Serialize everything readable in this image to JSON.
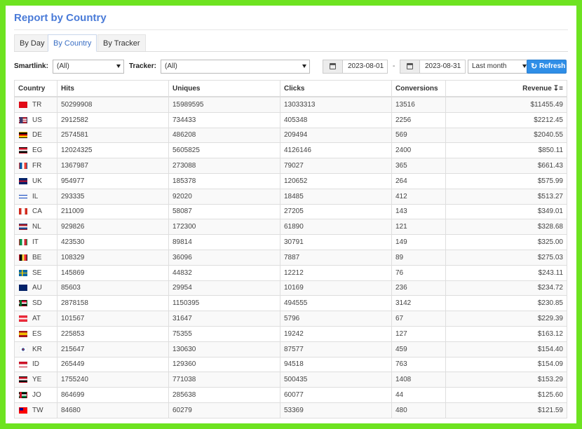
{
  "page": {
    "title": "Report by Country"
  },
  "tabs": [
    {
      "label": "By Day",
      "active": false
    },
    {
      "label": "By Country",
      "active": true
    },
    {
      "label": "By Tracker",
      "active": false
    }
  ],
  "filters": {
    "smartlink_label": "Smartlink:",
    "smartlink_value": "(All)",
    "tracker_label": "Tracker:",
    "tracker_value": "(All)",
    "date_from": "2023-08-01",
    "date_sep": "-",
    "date_to": "2023-08-31",
    "range_value": "Last month",
    "refresh_label": "Refresh"
  },
  "table": {
    "headers": {
      "country": "Country",
      "hits": "Hits",
      "uniques": "Uniques",
      "clicks": "Clicks",
      "conversions": "Conversions",
      "revenue": "Revenue"
    },
    "rows": [
      {
        "flag_css": "linear-gradient(#e30a17,#e30a17)",
        "code": "TR",
        "hits": "50299908",
        "uniques": "15989595",
        "clicks": "13033313",
        "conversions": "13516",
        "revenue": "$11455.49"
      },
      {
        "flag_css": "linear-gradient(to right,#3c3b6e 0,#3c3b6e 45%,transparent 45%),repeating-linear-gradient(#b22234 0,#b22234 1.4px,#fff 1.4px,#fff 2.8px)",
        "code": "US",
        "hits": "2912582",
        "uniques": "734433",
        "clicks": "405348",
        "conversions": "2256",
        "revenue": "$2212.45"
      },
      {
        "flag_css": "linear-gradient(#000 0,#000 33%,#dd0000 33%,#dd0000 66%,#ffce00 66%)",
        "code": "DE",
        "hits": "2574581",
        "uniques": "486208",
        "clicks": "209494",
        "conversions": "569",
        "revenue": "$2040.55"
      },
      {
        "flag_css": "linear-gradient(#ce1126 0,#ce1126 33%,#fff 33%,#fff 66%,#000 66%)",
        "code": "EG",
        "hits": "12024325",
        "uniques": "5605825",
        "clicks": "4126146",
        "conversions": "2400",
        "revenue": "$850.11"
      },
      {
        "flag_css": "linear-gradient(to right,#0055a4 0,#0055a4 33%,#fff 33%,#fff 66%,#ef4135 66%)",
        "code": "FR",
        "hits": "1367987",
        "uniques": "273088",
        "clicks": "79027",
        "conversions": "365",
        "revenue": "$661.43"
      },
      {
        "flag_css": "linear-gradient(#012169 0,#012169 38%,#c8102e 38%,#c8102e 62%,#012169 62%)",
        "code": "UK",
        "hits": "954977",
        "uniques": "185378",
        "clicks": "120652",
        "conversions": "264",
        "revenue": "$575.99"
      },
      {
        "flag_css": "linear-gradient(#fff 0,#fff 15%,#0038b8 15%,#0038b8 28%,#fff 28%,#fff 72%,#0038b8 72%,#0038b8 85%,#fff 85%)",
        "code": "IL",
        "hits": "293335",
        "uniques": "92020",
        "clicks": "18485",
        "conversions": "412",
        "revenue": "$513.27"
      },
      {
        "flag_css": "linear-gradient(to right,#d52b1e 0,#d52b1e 25%,#fff 25%,#fff 75%,#d52b1e 75%)",
        "code": "CA",
        "hits": "211009",
        "uniques": "58087",
        "clicks": "27205",
        "conversions": "143",
        "revenue": "$349.01"
      },
      {
        "flag_css": "linear-gradient(#ae1c28 0,#ae1c28 33%,#fff 33%,#fff 66%,#21468b 66%)",
        "code": "NL",
        "hits": "929826",
        "uniques": "172300",
        "clicks": "61890",
        "conversions": "121",
        "revenue": "$328.68"
      },
      {
        "flag_css": "linear-gradient(to right,#009246 0,#009246 33%,#fff 33%,#fff 66%,#ce2b37 66%)",
        "code": "IT",
        "hits": "423530",
        "uniques": "89814",
        "clicks": "30791",
        "conversions": "149",
        "revenue": "$325.00"
      },
      {
        "flag_css": "linear-gradient(to right,#000 0,#000 33%,#fae042 33%,#fae042 66%,#ed2939 66%)",
        "code": "BE",
        "hits": "108329",
        "uniques": "36096",
        "clicks": "7887",
        "conversions": "89",
        "revenue": "$275.03"
      },
      {
        "flag_css": "linear-gradient(to right,transparent 0,transparent 30%,#fecc00 30%,#fecc00 45%,transparent 45%),linear-gradient(#006aa7 0,#006aa7 40%,#fecc00 40%,#fecc00 60%,#006aa7 60%)",
        "code": "SE",
        "hits": "145869",
        "uniques": "44832",
        "clicks": "12212",
        "conversions": "76",
        "revenue": "$243.11"
      },
      {
        "flag_css": "linear-gradient(#012169,#012169)",
        "code": "AU",
        "hits": "85603",
        "uniques": "29954",
        "clicks": "10169",
        "conversions": "236",
        "revenue": "$234.72"
      },
      {
        "flag_css": "linear-gradient(to right,#007229 0,#007229 30%,transparent 30%),linear-gradient(#d21034 0,#d21034 33%,#fff 33%,#fff 66%,#000 66%)",
        "code": "SD",
        "hits": "2878158",
        "uniques": "1150395",
        "clicks": "494555",
        "conversions": "3142",
        "revenue": "$230.85"
      },
      {
        "flag_css": "linear-gradient(#ed2939 0,#ed2939 33%,#fff 33%,#fff 66%,#ed2939 66%)",
        "code": "AT",
        "hits": "101567",
        "uniques": "31647",
        "clicks": "5796",
        "conversions": "67",
        "revenue": "$229.39"
      },
      {
        "flag_css": "linear-gradient(#aa151b 0,#aa151b 25%,#f1bf00 25%,#f1bf00 75%,#aa151b 75%)",
        "code": "ES",
        "hits": "225853",
        "uniques": "75355",
        "clicks": "19242",
        "conversions": "127",
        "revenue": "$163.12"
      },
      {
        "flag_css": "radial-gradient(circle at 50% 50%,#cd2e3a 0,#cd2e3a 20%,#0047a0 21%,#0047a0 32%,#fff 33%)",
        "code": "KR",
        "hits": "215647",
        "uniques": "130630",
        "clicks": "87577",
        "conversions": "459",
        "revenue": "$154.40"
      },
      {
        "flag_css": "linear-gradient(#ce1126 0,#ce1126 50%,#fff 50%)",
        "code": "ID",
        "hits": "265449",
        "uniques": "129360",
        "clicks": "94518",
        "conversions": "763",
        "revenue": "$154.09"
      },
      {
        "flag_css": "linear-gradient(#ce1126 0,#ce1126 33%,#fff 33%,#fff 66%,#000 66%)",
        "code": "YE",
        "hits": "1755240",
        "uniques": "771038",
        "clicks": "500435",
        "conversions": "1408",
        "revenue": "$153.29"
      },
      {
        "flag_css": "linear-gradient(to right,#ce1126 0,#ce1126 30%,transparent 30%),linear-gradient(#000 0,#000 33%,#fff 33%,#fff 66%,#007a3d 66%)",
        "code": "JO",
        "hits": "864699",
        "uniques": "285638",
        "clicks": "60077",
        "conversions": "44",
        "revenue": "$125.60"
      },
      {
        "flag_css": "linear-gradient(to right,#000095 0,#000095 50%,transparent 50%) top left/100% 50% no-repeat,linear-gradient(#fe0000,#fe0000)",
        "code": "TW",
        "hits": "84680",
        "uniques": "60279",
        "clicks": "53369",
        "conversions": "480",
        "revenue": "$121.59"
      }
    ]
  },
  "colors": {
    "accent": "#4a7bd8",
    "refresh_button": "#2f8ee7",
    "outer_frame": "#6ee320"
  },
  "icons": {
    "calendar": "calendar-icon",
    "refresh": "refresh-icon",
    "sort": "sort-desc-icon",
    "dropdown": "chevron-down-icon"
  }
}
